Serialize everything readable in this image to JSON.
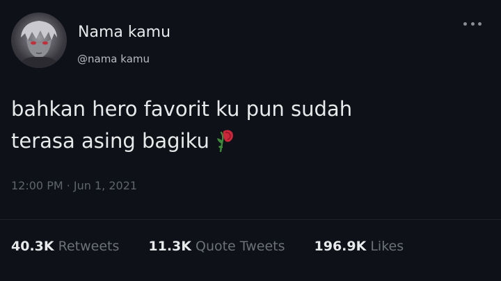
{
  "author": {
    "display_name": "Nama kamu",
    "handle": "@nama kamu"
  },
  "tweet": {
    "line1": "bahkan hero favorit ku pun sudah",
    "line2": "terasa asing bagiku",
    "emoji": "wilted-rose-icon",
    "timestamp": "12:00 PM · Jun 1, 2021"
  },
  "stats": {
    "retweets_count": "40.3K",
    "retweets_label": "Retweets",
    "quotes_count": "11.3K",
    "quotes_label": "Quote Tweets",
    "likes_count": "196.9K",
    "likes_label": "Likes"
  },
  "colors": {
    "background": "#0e1117",
    "text": "#e7e9ea",
    "secondary": "#6c7278"
  }
}
